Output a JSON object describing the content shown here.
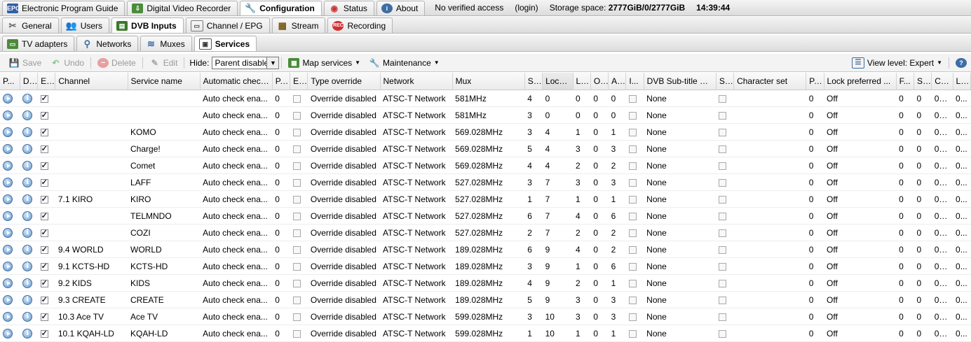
{
  "top_tabs": [
    {
      "label": "Electronic Program Guide",
      "icon": "epg-icon"
    },
    {
      "label": "Digital Video Recorder",
      "icon": "dvr-icon"
    },
    {
      "label": "Configuration",
      "icon": "wrench-icon",
      "active": true
    },
    {
      "label": "Status",
      "icon": "eye-icon"
    },
    {
      "label": "About",
      "icon": "info-icon"
    }
  ],
  "status": {
    "access": "No verified access",
    "login": "(login)",
    "storage_label": "Storage space:",
    "storage_value": "2777GiB/0/2777GiB",
    "time": "14:39:44"
  },
  "config_tabs": [
    {
      "label": "General",
      "icon": "tools-icon"
    },
    {
      "label": "Users",
      "icon": "users-icon"
    },
    {
      "label": "DVB Inputs",
      "icon": "dvb-icon",
      "active": true
    },
    {
      "label": "Channel / EPG",
      "icon": "channel-icon"
    },
    {
      "label": "Stream",
      "icon": "stream-icon"
    },
    {
      "label": "Recording",
      "icon": "rec-icon"
    }
  ],
  "dvb_tabs": [
    {
      "label": "TV adapters",
      "icon": "adapter-icon"
    },
    {
      "label": "Networks",
      "icon": "antenna-icon"
    },
    {
      "label": "Muxes",
      "icon": "muxes-icon"
    },
    {
      "label": "Services",
      "icon": "services-icon",
      "active": true
    }
  ],
  "toolbar": {
    "save": "Save",
    "undo": "Undo",
    "delete": "Delete",
    "edit": "Edit",
    "hide_label": "Hide:",
    "hide_value": "Parent disable",
    "map_services": "Map services",
    "maintenance": "Maintenance",
    "view_level": "View level: Expert"
  },
  "columns": [
    "P...",
    "D...",
    "E...",
    "Channel",
    "Service name",
    "Automatic check...",
    "P...",
    "E...",
    "Type override",
    "Network",
    "Mux",
    "S...",
    "Loca...",
    "L...",
    "O...",
    "A...",
    "I...",
    "DVB Sub-title Pr...",
    "S...",
    "Character set",
    "P...",
    "Lock preferred ...",
    "F...",
    "S...",
    "Cre...",
    "L..."
  ],
  "rows": [
    {
      "channel": "",
      "service": "",
      "auto": "Auto check ena...",
      "p": "0",
      "type": "Override disabled",
      "network": "ATSC-T Network",
      "mux": "581MHz",
      "s": "4",
      "loc": "0",
      "l": "0",
      "o": "0",
      "a": "0",
      "dvbsub": "None",
      "p2": "0",
      "lock": "Off",
      "f": "0",
      "s2": "0",
      "cre": "06/...",
      "l2": "0..."
    },
    {
      "channel": "",
      "service": "",
      "auto": "Auto check ena...",
      "p": "0",
      "type": "Override disabled",
      "network": "ATSC-T Network",
      "mux": "581MHz",
      "s": "3",
      "loc": "0",
      "l": "0",
      "o": "0",
      "a": "0",
      "dvbsub": "None",
      "p2": "0",
      "lock": "Off",
      "f": "0",
      "s2": "0",
      "cre": "06/...",
      "l2": "0..."
    },
    {
      "channel": "",
      "service": "KOMO",
      "auto": "Auto check ena...",
      "p": "0",
      "type": "Override disabled",
      "network": "ATSC-T Network",
      "mux": "569.028MHz",
      "s": "3",
      "loc": "4",
      "l": "1",
      "o": "0",
      "a": "1",
      "dvbsub": "None",
      "p2": "0",
      "lock": "Off",
      "f": "0",
      "s2": "0",
      "cre": "06/...",
      "l2": "0..."
    },
    {
      "channel": "",
      "service": "Charge!",
      "auto": "Auto check ena...",
      "p": "0",
      "type": "Override disabled",
      "network": "ATSC-T Network",
      "mux": "569.028MHz",
      "s": "5",
      "loc": "4",
      "l": "3",
      "o": "0",
      "a": "3",
      "dvbsub": "None",
      "p2": "0",
      "lock": "Off",
      "f": "0",
      "s2": "0",
      "cre": "06/...",
      "l2": "0..."
    },
    {
      "channel": "",
      "service": "Comet",
      "auto": "Auto check ena...",
      "p": "0",
      "type": "Override disabled",
      "network": "ATSC-T Network",
      "mux": "569.028MHz",
      "s": "4",
      "loc": "4",
      "l": "2",
      "o": "0",
      "a": "2",
      "dvbsub": "None",
      "p2": "0",
      "lock": "Off",
      "f": "0",
      "s2": "0",
      "cre": "06/...",
      "l2": "0..."
    },
    {
      "channel": "",
      "service": "LAFF",
      "auto": "Auto check ena...",
      "p": "0",
      "type": "Override disabled",
      "network": "ATSC-T Network",
      "mux": "527.028MHz",
      "s": "3",
      "loc": "7",
      "l": "3",
      "o": "0",
      "a": "3",
      "dvbsub": "None",
      "p2": "0",
      "lock": "Off",
      "f": "0",
      "s2": "0",
      "cre": "06/...",
      "l2": "0..."
    },
    {
      "channel": "7.1 KIRO",
      "service": "KIRO",
      "auto": "Auto check ena...",
      "p": "0",
      "type": "Override disabled",
      "network": "ATSC-T Network",
      "mux": "527.028MHz",
      "s": "1",
      "loc": "7",
      "l": "1",
      "o": "0",
      "a": "1",
      "dvbsub": "None",
      "p2": "0",
      "lock": "Off",
      "f": "0",
      "s2": "0",
      "cre": "06/...",
      "l2": "0..."
    },
    {
      "channel": "",
      "service": "TELMNDO",
      "auto": "Auto check ena...",
      "p": "0",
      "type": "Override disabled",
      "network": "ATSC-T Network",
      "mux": "527.028MHz",
      "s": "6",
      "loc": "7",
      "l": "4",
      "o": "0",
      "a": "6",
      "dvbsub": "None",
      "p2": "0",
      "lock": "Off",
      "f": "0",
      "s2": "0",
      "cre": "06/...",
      "l2": "0..."
    },
    {
      "channel": "",
      "service": "COZI",
      "auto": "Auto check ena...",
      "p": "0",
      "type": "Override disabled",
      "network": "ATSC-T Network",
      "mux": "527.028MHz",
      "s": "2",
      "loc": "7",
      "l": "2",
      "o": "0",
      "a": "2",
      "dvbsub": "None",
      "p2": "0",
      "lock": "Off",
      "f": "0",
      "s2": "0",
      "cre": "06/...",
      "l2": "0..."
    },
    {
      "channel": "9.4 WORLD",
      "service": "WORLD",
      "auto": "Auto check ena...",
      "p": "0",
      "type": "Override disabled",
      "network": "ATSC-T Network",
      "mux": "189.028MHz",
      "s": "6",
      "loc": "9",
      "l": "4",
      "o": "0",
      "a": "2",
      "dvbsub": "None",
      "p2": "0",
      "lock": "Off",
      "f": "0",
      "s2": "0",
      "cre": "06/...",
      "l2": "0..."
    },
    {
      "channel": "9.1 KCTS-HD",
      "service": "KCTS-HD",
      "auto": "Auto check ena...",
      "p": "0",
      "type": "Override disabled",
      "network": "ATSC-T Network",
      "mux": "189.028MHz",
      "s": "3",
      "loc": "9",
      "l": "1",
      "o": "0",
      "a": "6",
      "dvbsub": "None",
      "p2": "0",
      "lock": "Off",
      "f": "0",
      "s2": "0",
      "cre": "06/...",
      "l2": "0..."
    },
    {
      "channel": "9.2 KIDS",
      "service": "KIDS",
      "auto": "Auto check ena...",
      "p": "0",
      "type": "Override disabled",
      "network": "ATSC-T Network",
      "mux": "189.028MHz",
      "s": "4",
      "loc": "9",
      "l": "2",
      "o": "0",
      "a": "1",
      "dvbsub": "None",
      "p2": "0",
      "lock": "Off",
      "f": "0",
      "s2": "0",
      "cre": "06/...",
      "l2": "0..."
    },
    {
      "channel": "9.3 CREATE",
      "service": "CREATE",
      "auto": "Auto check ena...",
      "p": "0",
      "type": "Override disabled",
      "network": "ATSC-T Network",
      "mux": "189.028MHz",
      "s": "5",
      "loc": "9",
      "l": "3",
      "o": "0",
      "a": "3",
      "dvbsub": "None",
      "p2": "0",
      "lock": "Off",
      "f": "0",
      "s2": "0",
      "cre": "06/...",
      "l2": "0..."
    },
    {
      "channel": "10.3 Ace TV",
      "service": "Ace TV",
      "auto": "Auto check ena...",
      "p": "0",
      "type": "Override disabled",
      "network": "ATSC-T Network",
      "mux": "599.028MHz",
      "s": "3",
      "loc": "10",
      "l": "3",
      "o": "0",
      "a": "3",
      "dvbsub": "None",
      "p2": "0",
      "lock": "Off",
      "f": "0",
      "s2": "0",
      "cre": "06/...",
      "l2": "0..."
    },
    {
      "channel": "10.1 KQAH-LD",
      "service": "KQAH-LD",
      "auto": "Auto check ena...",
      "p": "0",
      "type": "Override disabled",
      "network": "ATSC-T Network",
      "mux": "599.028MHz",
      "s": "1",
      "loc": "10",
      "l": "1",
      "o": "0",
      "a": "1",
      "dvbsub": "None",
      "p2": "0",
      "lock": "Off",
      "f": "0",
      "s2": "0",
      "cre": "06/...",
      "l2": "0..."
    }
  ]
}
